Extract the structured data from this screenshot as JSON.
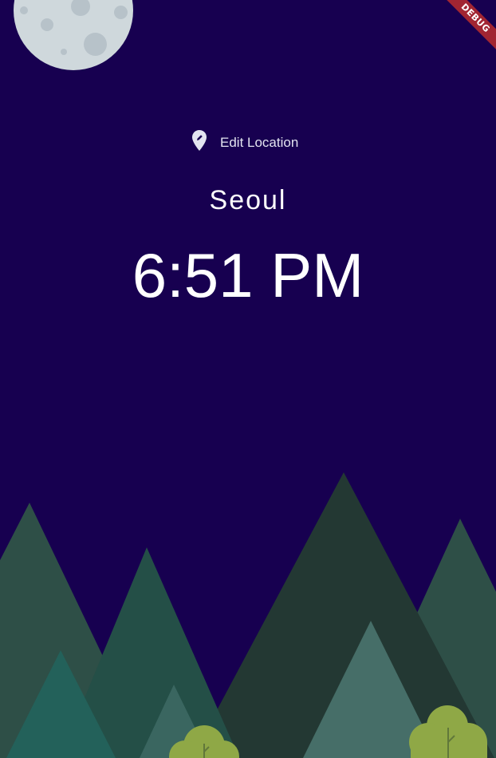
{
  "debug_banner": {
    "label": "DEBUG"
  },
  "location_button": {
    "label": "Edit Location",
    "icon": "location-pin-edit-icon"
  },
  "location": {
    "city": "Seoul"
  },
  "clock": {
    "time": "6:51 PM"
  },
  "theme": {
    "background": "#170050",
    "moon": "#cfd8dc",
    "mountains": [
      "#2e4f47",
      "#244f47",
      "#233833",
      "#2e4f47",
      "#23615a",
      "#3a6660",
      "#466e68"
    ],
    "trees": "#8fa846"
  }
}
